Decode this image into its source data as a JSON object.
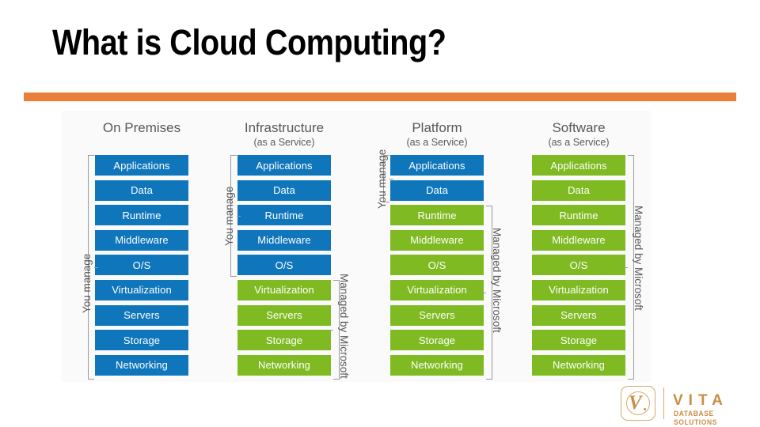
{
  "slide": {
    "title": "What is Cloud Computing?",
    "accent_color": "#E8803A",
    "blue_color": "#1076BC",
    "green_color": "#7FBA22"
  },
  "diagram": {
    "layers": [
      "Applications",
      "Data",
      "Runtime",
      "Middleware",
      "O/S",
      "Virtualization",
      "Servers",
      "Storage",
      "Networking"
    ],
    "manage_label": "You manage",
    "managed_label": "Managed by Microsoft",
    "columns": [
      {
        "key": "on-premises",
        "title": "On Premises",
        "subtitle": "",
        "blue_count": 9,
        "green_count": 0,
        "you_manage": true,
        "managed_by_microsoft": false
      },
      {
        "key": "infrastructure-as-a-service",
        "title": "Infrastructure",
        "subtitle": "(as a Service)",
        "blue_count": 5,
        "green_count": 4,
        "you_manage": true,
        "managed_by_microsoft": true
      },
      {
        "key": "platform-as-a-service",
        "title": "Platform",
        "subtitle": "(as a Service)",
        "blue_count": 2,
        "green_count": 7,
        "you_manage": true,
        "managed_by_microsoft": true
      },
      {
        "key": "software-as-a-service",
        "title": "Software",
        "subtitle": "(as a Service)",
        "blue_count": 0,
        "green_count": 9,
        "you_manage": false,
        "managed_by_microsoft": true
      }
    ]
  },
  "logo": {
    "name": "VITA",
    "tagline": "DATABASE SOLUTIONS",
    "mark_letter": "V",
    "color": "#C98E45"
  }
}
